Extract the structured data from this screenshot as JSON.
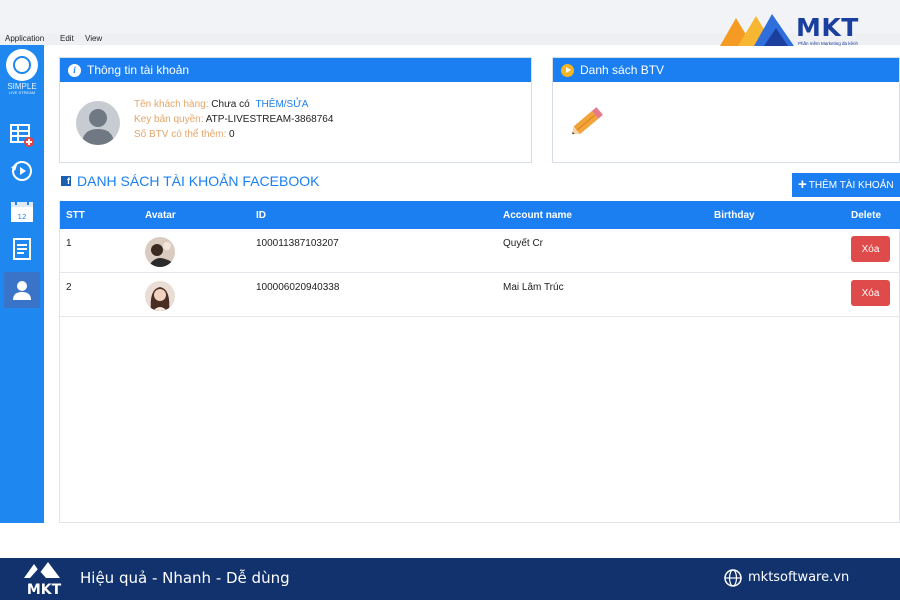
{
  "menu": [
    "Application",
    "Edit",
    "View"
  ],
  "brand": {
    "name": "MKT",
    "tagline": "Phần mềm Marketing đa kênh"
  },
  "sidebar": {
    "app_name": "SIMPLE",
    "app_sub": "LIVE STREAM"
  },
  "account_card": {
    "title": "Thông tin tài khoản",
    "customer_label": "Tên khách hàng:",
    "customer_value": "Chưa có",
    "edit_link": "THÊM/SỬA",
    "key_label": "Key bản quyền:",
    "key_value": "ATP-LIVESTREAM-3868764",
    "btv_label": "Số BTV có thể thêm:",
    "btv_value": "0"
  },
  "btv_card": {
    "title": "Danh sách BTV"
  },
  "fb_section": {
    "title": "DANH SÁCH TÀI KHOẢN FACEBOOK",
    "add_button": "THÊM TÀI KHOẢN"
  },
  "table": {
    "headers": [
      "STT",
      "Avatar",
      "ID",
      "Account name",
      "Birthday",
      "Delete"
    ],
    "rows": [
      {
        "stt": "1",
        "id": "100011387103207",
        "name": "Quyết Cr",
        "birthday": "",
        "delete": "Xóa"
      },
      {
        "stt": "2",
        "id": "100006020940338",
        "name": "Mai Lâm Trúc",
        "birthday": "",
        "delete": "Xóa"
      }
    ]
  },
  "footer": {
    "slogan": "Hiệu quả - Nhanh - Dễ dùng",
    "website": "mktsoftware.vn"
  },
  "colors": {
    "primary": "#1b7ff2",
    "sidebar": "#1e88f0",
    "danger": "#df4a4a",
    "footer": "#12326e"
  }
}
